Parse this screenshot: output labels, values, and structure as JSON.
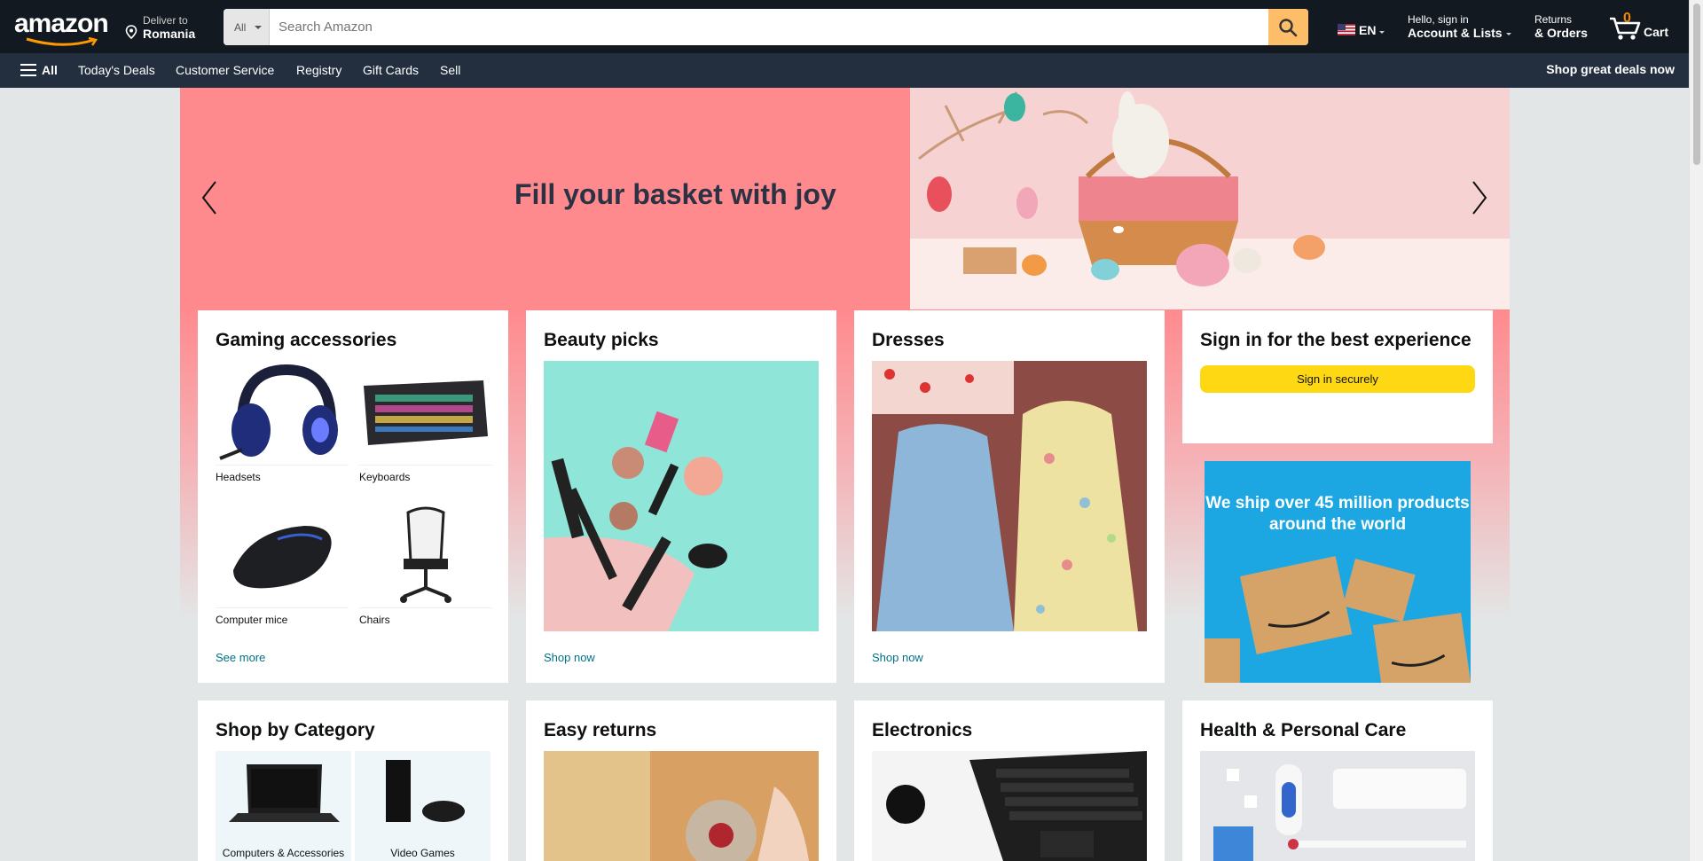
{
  "header": {
    "logo_text": "amazon",
    "deliver_line1": "Deliver to",
    "deliver_line2": "Romania",
    "search_category": "All",
    "search_placeholder": "Search Amazon",
    "language": "EN",
    "account_line1": "Hello, sign in",
    "account_line2": "Account & Lists",
    "returns_line1": "Returns",
    "returns_line2": "& Orders",
    "cart_count": "0",
    "cart_label": "Cart"
  },
  "subnav": {
    "all_label": "All",
    "items": [
      "Today's Deals",
      "Customer Service",
      "Registry",
      "Gift Cards",
      "Sell"
    ],
    "promo": "Shop great deals now"
  },
  "hero": {
    "title": "Fill your basket with joy"
  },
  "cards": {
    "gaming": {
      "title": "Gaming accessories",
      "items": [
        "Headsets",
        "Keyboards",
        "Computer mice",
        "Chairs"
      ],
      "link": "See more"
    },
    "beauty": {
      "title": "Beauty picks",
      "link": "Shop now"
    },
    "dresses": {
      "title": "Dresses",
      "link": "Shop now"
    },
    "signin": {
      "title": "Sign in for the best experience",
      "button": "Sign in securely"
    },
    "ship_banner": "We ship over 45 million products around the world",
    "category": {
      "title": "Shop by Category",
      "items": [
        "Computers & Accessories",
        "Video Games"
      ]
    },
    "returns": {
      "title": "Easy returns"
    },
    "electronics": {
      "title": "Electronics"
    },
    "health": {
      "title": "Health & Personal Care"
    }
  },
  "colors": {
    "nav_dark": "#131921",
    "subnav": "#232f3e",
    "search_button": "#febd69",
    "cart_accent": "#f08804",
    "hero_pink": "#ff8a8e",
    "signin_yellow": "#ffd814",
    "link_teal": "#007185",
    "ship_blue": "#1ca7e3"
  }
}
